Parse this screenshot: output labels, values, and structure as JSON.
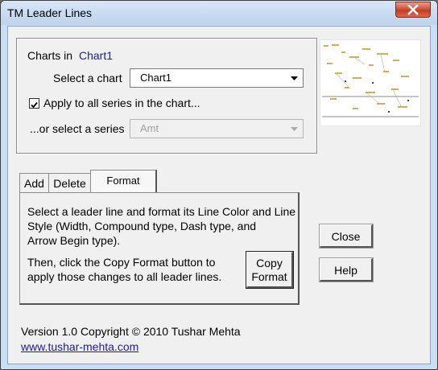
{
  "window": {
    "title": "TM Leader Lines"
  },
  "charts_in": {
    "label": "Charts in",
    "chart_name": "Chart1"
  },
  "select_chart": {
    "label": "Select a chart",
    "value": "Chart1"
  },
  "apply_all": {
    "label": "Apply to all series in the chart...",
    "checked": true
  },
  "select_series": {
    "label": "...or select a series",
    "value": "Amt",
    "enabled": false
  },
  "tabs": [
    {
      "label": "Add"
    },
    {
      "label": "Delete"
    },
    {
      "label": "Format",
      "selected": true
    }
  ],
  "format_tab": {
    "instructions": [
      "Select a leader line and format its Line Color and Line",
      "Style (Width, Compound type, Dash type, and",
      "Arrow Begin type)."
    ],
    "then_text": [
      "Then, click the Copy Format button to",
      "apply those changes to all leader lines."
    ],
    "copy_button": [
      "Copy",
      "Format"
    ]
  },
  "buttons": {
    "close": "Close",
    "help": "Help"
  },
  "footer": {
    "version": "Version 1.0 Copyright © 2010 Tushar Mehta",
    "link": "www.tushar-mehta.com"
  },
  "icons": {
    "close": "close-icon",
    "dropdown": "chevron-down-icon",
    "checkbox": "check-icon"
  },
  "colors": {
    "link": "#1a1aa6",
    "title_close_button": "#c43b22",
    "window_frame": "#c9dff3"
  }
}
